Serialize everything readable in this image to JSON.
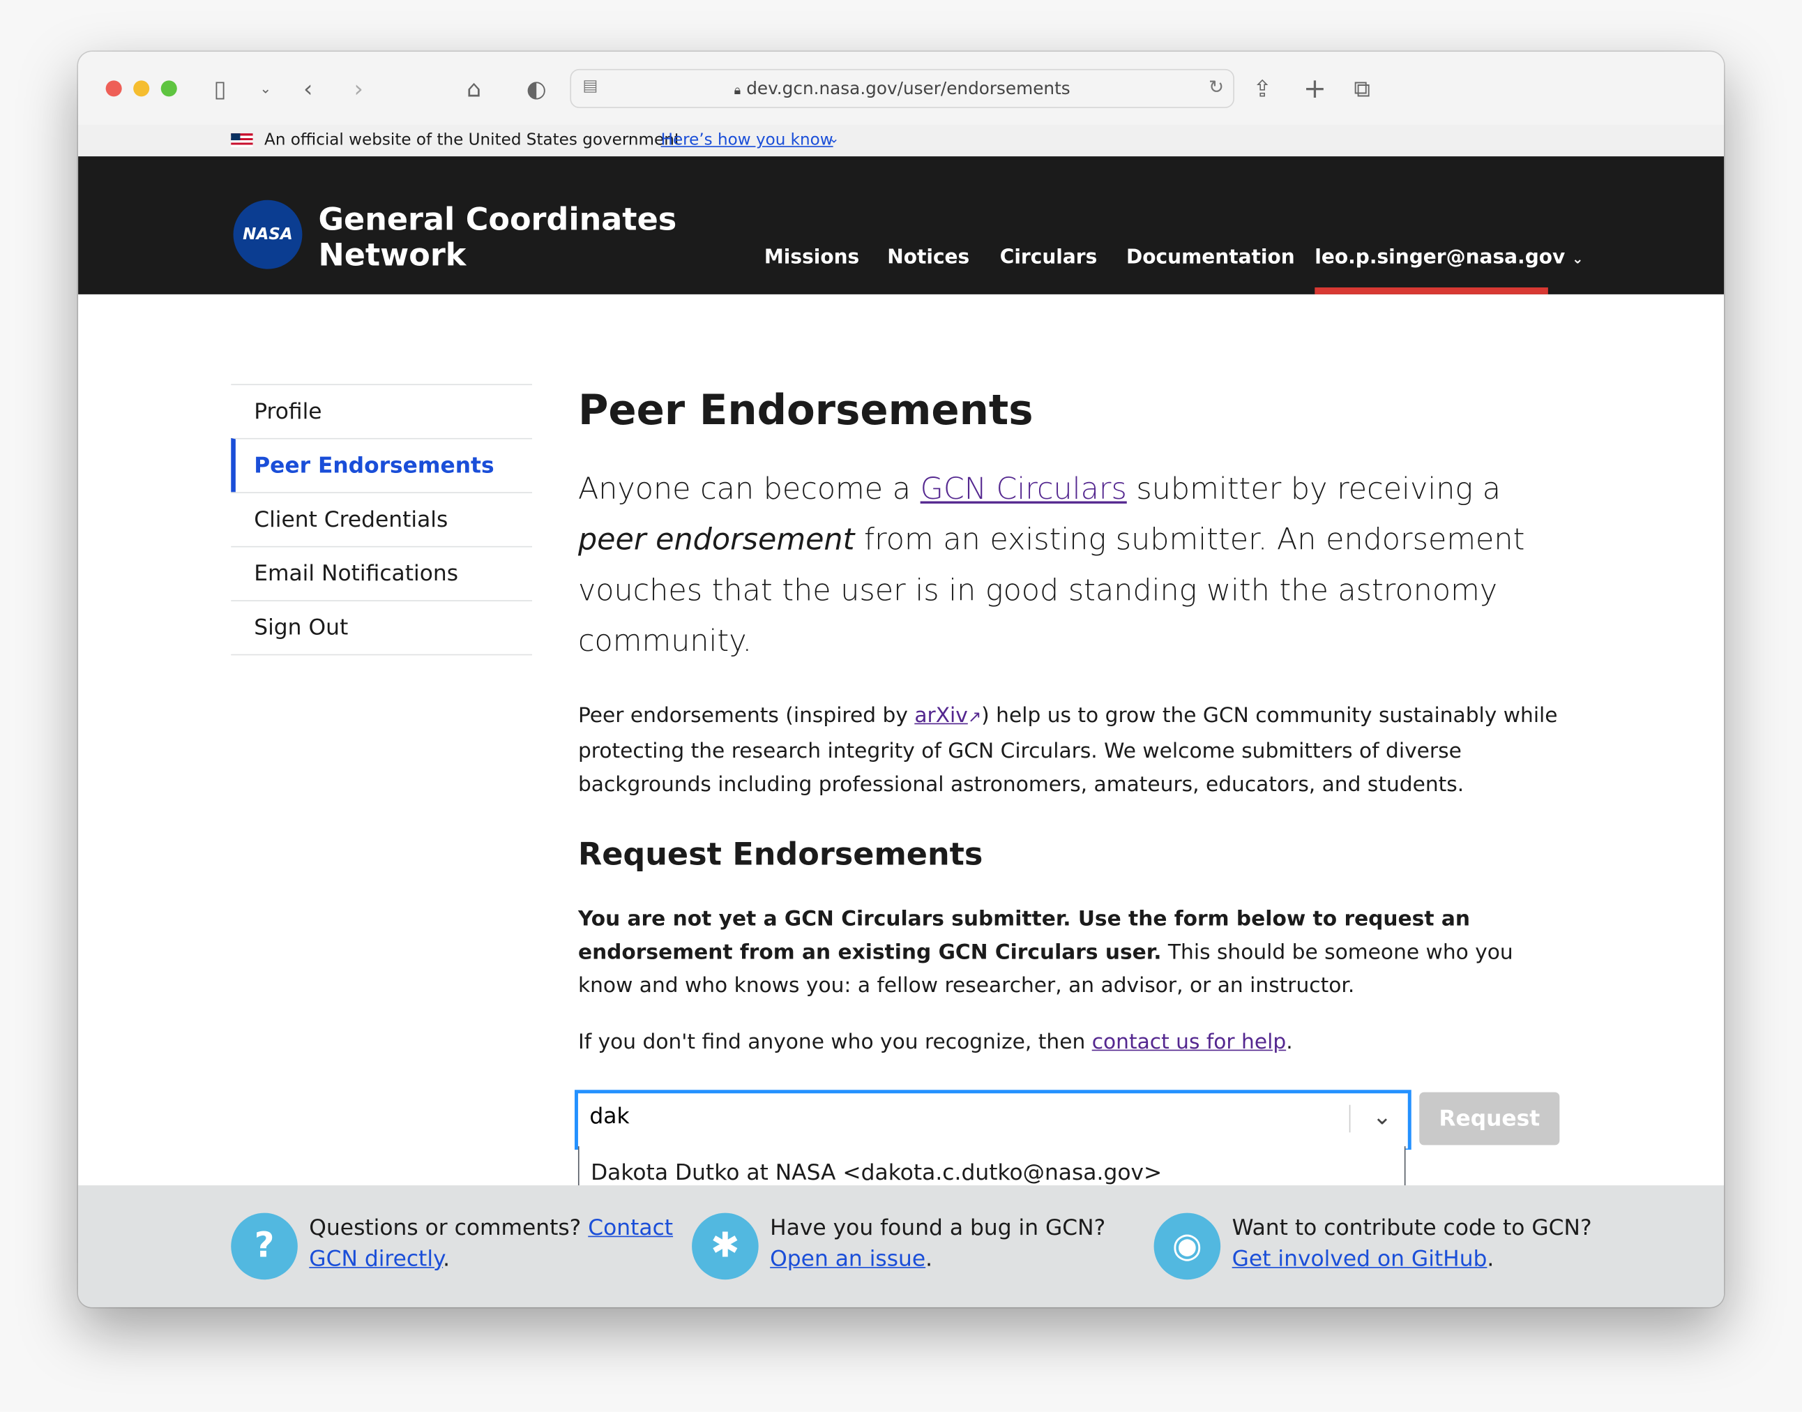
{
  "browser": {
    "url": "dev.gcn.nasa.gov/user/endorsements"
  },
  "gov_banner": {
    "text": "An official website of the United States government",
    "link": "Here’s how you know"
  },
  "header": {
    "logo_text": "NASA",
    "title_line1": "General Coordinates",
    "title_line2": "Network",
    "nav": [
      "Missions",
      "Notices",
      "Circulars",
      "Documentation",
      "leo.p.singer@nasa.gov"
    ]
  },
  "sidebar": {
    "items": [
      {
        "label": "Profile"
      },
      {
        "label": "Peer Endorsements"
      },
      {
        "label": "Client Credentials"
      },
      {
        "label": "Email Notifications"
      },
      {
        "label": "Sign Out"
      }
    ]
  },
  "main": {
    "title": "Peer Endorsements",
    "lead": {
      "a": "Anyone can become a ",
      "link": "GCN Circulars",
      "b": " submitter by receiving a ",
      "em": "peer endorsement",
      "c": " from an existing submitter. An endorsement vouches that the user is in good standing with the astronomy community."
    },
    "para": {
      "a": "Peer endorsements (inspired by ",
      "link": "arXiv",
      "b": ") help us to grow the GCN community sustainably while protecting the research integrity of GCN Circulars. We welcome submitters of diverse backgrounds including professional astronomers, amateurs, educators, and students."
    },
    "section_title": "Request Endorsements",
    "notice": {
      "bold": "You are not yet a GCN Circulars submitter. Use the form below to request an endorsement from an existing GCN Circulars user.",
      "rest": " This should be someone who you know and who knows you: a fellow researcher, an advisor, or an instructor."
    },
    "help": {
      "a": "If you don't find anyone who you recognize, then ",
      "link": "contact us for help",
      "b": "."
    },
    "combo_value": "dak",
    "option": "Dakota Dutko at NASA <dakota.c.dutko@nasa.gov>",
    "request_label": "Request"
  },
  "footer": [
    {
      "text": "Questions or comments? ",
      "link": "Contact GCN directly",
      "end": "."
    },
    {
      "text": "Have you found a bug in GCN?",
      "link": "Open an issue",
      "end": "."
    },
    {
      "text": "Want to contribute code to GCN?",
      "link": "Get involved on GitHub",
      "end": "."
    }
  ]
}
